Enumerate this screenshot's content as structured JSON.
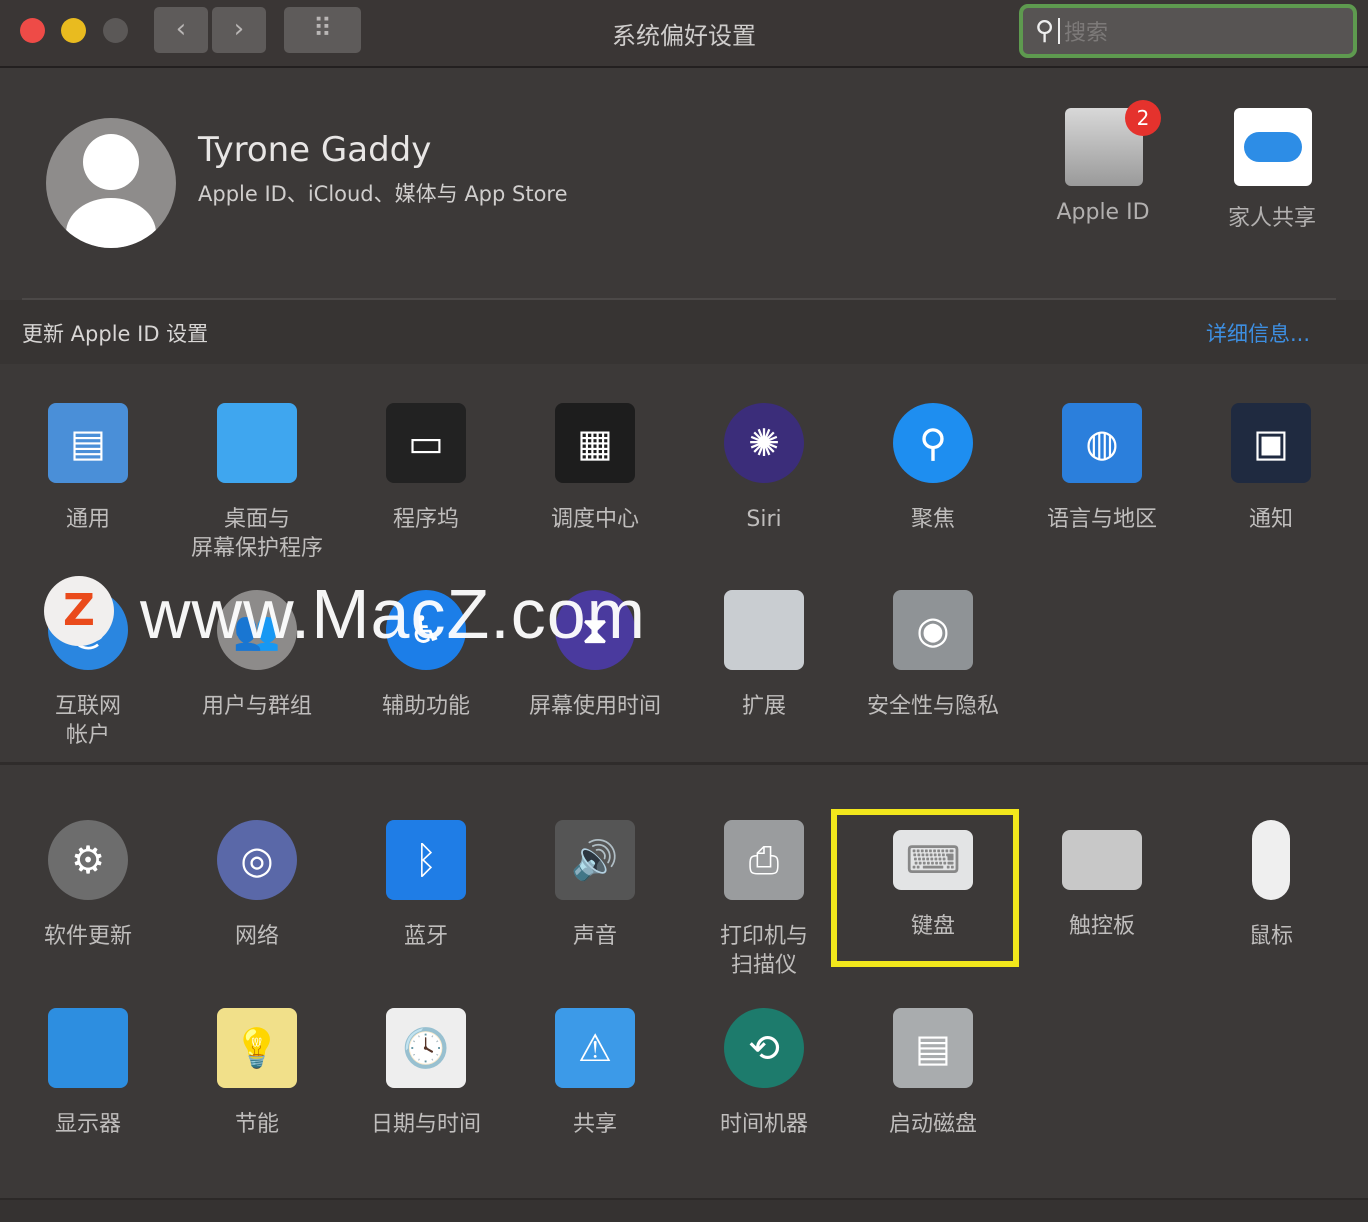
{
  "window": {
    "title": "系统偏好设置",
    "search_placeholder": "搜索",
    "back": "‹",
    "forward": "›",
    "grid": "⠿"
  },
  "user": {
    "name": "Tyrone Gaddy",
    "subtitle": "Apple ID、iCloud、媒体与 App Store"
  },
  "top_items": [
    {
      "label": "Apple ID",
      "badge": "2"
    },
    {
      "label": "家人共享"
    }
  ],
  "banner": {
    "text": "更新 Apple ID 设置",
    "link": "详细信息..."
  },
  "watermark": {
    "text": "www.MacZ.com",
    "logo": "Z"
  },
  "sections": [
    [
      {
        "label": "通用",
        "icon": "general-icon",
        "color": "#4a8fd8",
        "glyph": "▤"
      },
      {
        "label": "桌面与\n屏幕保护程序",
        "icon": "desktop-icon",
        "color": "#3fa6ef",
        "glyph": ""
      },
      {
        "label": "程序坞",
        "icon": "dock-icon",
        "color": "#222",
        "glyph": "▭"
      },
      {
        "label": "调度中心",
        "icon": "mission-control-icon",
        "color": "#1d1d1d",
        "glyph": "▦"
      },
      {
        "label": "Siri",
        "icon": "siri-icon",
        "color": "#3b2d7a",
        "glyph": "✺"
      },
      {
        "label": "聚焦",
        "icon": "spotlight-icon",
        "color": "#1e8ef0",
        "glyph": "⚲"
      },
      {
        "label": "语言与地区",
        "icon": "language-icon",
        "color": "#2b7fdc",
        "glyph": "◍"
      },
      {
        "label": "通知",
        "icon": "notifications-icon",
        "color": "#1f2a40",
        "glyph": "▣"
      },
      {
        "label": "互联网\n帐户",
        "icon": "internet-accounts-icon",
        "color": "#2a86e0",
        "glyph": "@"
      },
      {
        "label": "用户与群组",
        "icon": "users-groups-icon",
        "color": "#8d8b8a",
        "glyph": "👥"
      },
      {
        "label": "辅助功能",
        "icon": "accessibility-icon",
        "color": "#1c7ee8",
        "glyph": "♿"
      },
      {
        "label": "屏幕使用时间",
        "icon": "screen-time-icon",
        "color": "#4a3a9e",
        "glyph": "⧗"
      },
      {
        "label": "扩展",
        "icon": "extensions-icon",
        "color": "#c9cdd1",
        "glyph": ""
      },
      {
        "label": "安全性与隐私",
        "icon": "security-icon",
        "color": "#8f9396",
        "glyph": "◉"
      }
    ],
    [
      {
        "label": "软件更新",
        "icon": "software-update-icon",
        "color": "#6d6d6d",
        "glyph": "⚙"
      },
      {
        "label": "网络",
        "icon": "network-icon",
        "color": "#5a68a8",
        "glyph": "◎"
      },
      {
        "label": "蓝牙",
        "icon": "bluetooth-icon",
        "color": "#1f7de6",
        "glyph": "ᛒ"
      },
      {
        "label": "声音",
        "icon": "sound-icon",
        "color": "#555",
        "glyph": "🔊"
      },
      {
        "label": "打印机与\n扫描仪",
        "icon": "printer-icon",
        "color": "#9a9c9e",
        "glyph": "⎙"
      },
      {
        "label": "键盘",
        "icon": "keyboard-icon",
        "color": "#e3e4e5",
        "glyph": "⌨"
      },
      {
        "label": "触控板",
        "icon": "trackpad-icon",
        "color": "#c8c8c8",
        "glyph": ""
      },
      {
        "label": "鼠标",
        "icon": "mouse-icon",
        "color": "#efefef",
        "glyph": ""
      },
      {
        "label": "显示器",
        "icon": "displays-icon",
        "color": "#2d8ee0",
        "glyph": ""
      },
      {
        "label": "节能",
        "icon": "energy-saver-icon",
        "color": "#f1e08a",
        "glyph": "💡"
      },
      {
        "label": "日期与时间",
        "icon": "date-time-icon",
        "color": "#eeeeee",
        "glyph": "🕓"
      },
      {
        "label": "共享",
        "icon": "sharing-icon",
        "color": "#3c9ae8",
        "glyph": "⚠"
      },
      {
        "label": "时间机器",
        "icon": "time-machine-icon",
        "color": "#1d7b6c",
        "glyph": "⟲"
      },
      {
        "label": "启动磁盘",
        "icon": "startup-disk-icon",
        "color": "#a9acae",
        "glyph": "▤"
      }
    ]
  ]
}
